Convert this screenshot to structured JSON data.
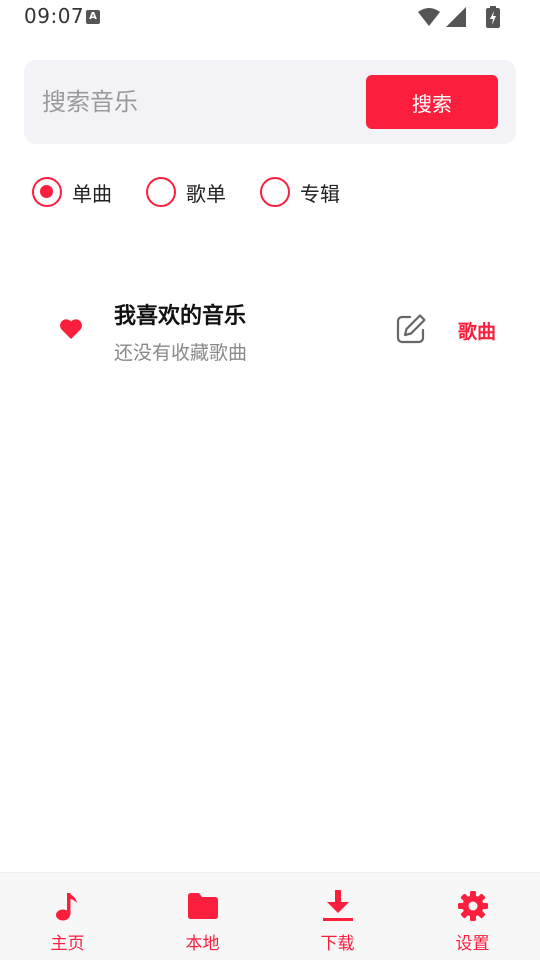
{
  "status_bar": {
    "time": "09:07",
    "a_badge": "A"
  },
  "search": {
    "placeholder": "搜索音乐",
    "value": "",
    "button_label": "搜索"
  },
  "radio_options": [
    {
      "label": "单曲",
      "checked": true
    },
    {
      "label": "歌单",
      "checked": false
    },
    {
      "label": "专辑",
      "checked": false
    }
  ],
  "playlist": {
    "title": "我喜欢的音乐",
    "subtitle": "还没有收藏歌曲",
    "tag": "歌曲",
    "icon": "heart-icon"
  },
  "bottom_nav": [
    {
      "label": "主页",
      "icon": "music-note-icon"
    },
    {
      "label": "本地",
      "icon": "folder-icon"
    },
    {
      "label": "下载",
      "icon": "download-icon"
    },
    {
      "label": "设置",
      "icon": "gear-icon"
    }
  ],
  "colors": {
    "accent": "#fb1f3d",
    "search_bg": "#f2f2f7",
    "nav_bg": "#f7f7f7"
  }
}
